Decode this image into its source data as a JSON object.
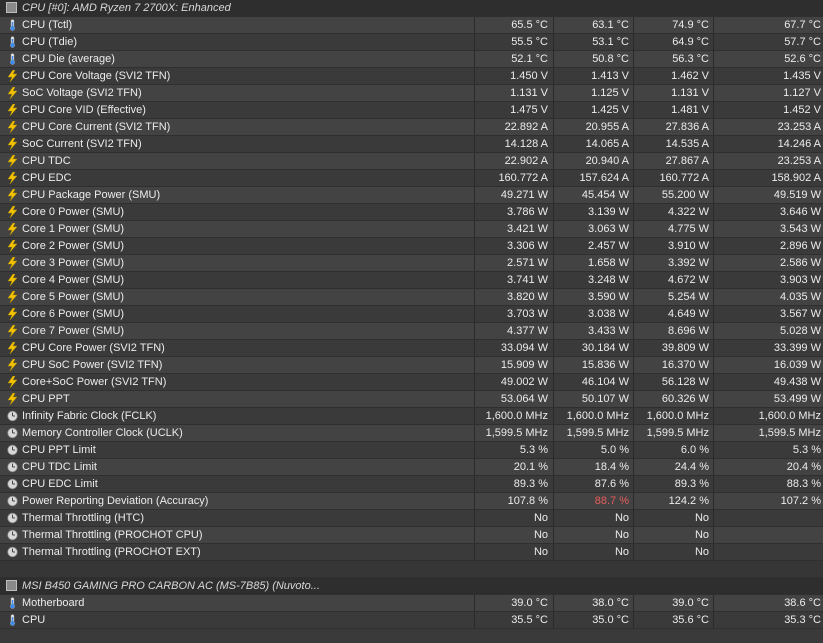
{
  "groups": [
    {
      "title": "CPU [#0]: AMD Ryzen 7 2700X: Enhanced",
      "icon": "chip-icon",
      "rows": [
        {
          "icon": "thermometer-icon",
          "name": "CPU (Tctl)",
          "current": "65.5 °C",
          "min": "63.1 °C",
          "max": "74.9 °C",
          "avg": "67.7 °C"
        },
        {
          "icon": "thermometer-icon",
          "name": "CPU (Tdie)",
          "current": "55.5 °C",
          "min": "53.1 °C",
          "max": "64.9 °C",
          "avg": "57.7 °C"
        },
        {
          "icon": "thermometer-icon",
          "name": "CPU Die (average)",
          "current": "52.1 °C",
          "min": "50.8 °C",
          "max": "56.3 °C",
          "avg": "52.6 °C"
        },
        {
          "icon": "lightning-icon",
          "name": "CPU Core Voltage (SVI2 TFN)",
          "current": "1.450 V",
          "min": "1.413 V",
          "max": "1.462 V",
          "avg": "1.435 V"
        },
        {
          "icon": "lightning-icon",
          "name": "SoC Voltage (SVI2 TFN)",
          "current": "1.131 V",
          "min": "1.125 V",
          "max": "1.131 V",
          "avg": "1.127 V"
        },
        {
          "icon": "lightning-icon",
          "name": "CPU Core VID (Effective)",
          "current": "1.475 V",
          "min": "1.425 V",
          "max": "1.481 V",
          "avg": "1.452 V"
        },
        {
          "icon": "lightning-icon",
          "name": "CPU Core Current (SVI2 TFN)",
          "current": "22.892 A",
          "min": "20.955 A",
          "max": "27.836 A",
          "avg": "23.253 A"
        },
        {
          "icon": "lightning-icon",
          "name": "SoC Current (SVI2 TFN)",
          "current": "14.128 A",
          "min": "14.065 A",
          "max": "14.535 A",
          "avg": "14.246 A"
        },
        {
          "icon": "lightning-icon",
          "name": "CPU TDC",
          "current": "22.902 A",
          "min": "20.940 A",
          "max": "27.867 A",
          "avg": "23.253 A"
        },
        {
          "icon": "lightning-icon",
          "name": "CPU EDC",
          "current": "160.772 A",
          "min": "157.624 A",
          "max": "160.772 A",
          "avg": "158.902 A"
        },
        {
          "icon": "lightning-icon",
          "name": "CPU Package Power (SMU)",
          "current": "49.271 W",
          "min": "45.454 W",
          "max": "55.200 W",
          "avg": "49.519 W"
        },
        {
          "icon": "lightning-icon",
          "name": "Core 0 Power (SMU)",
          "current": "3.786 W",
          "min": "3.139 W",
          "max": "4.322 W",
          "avg": "3.646 W"
        },
        {
          "icon": "lightning-icon",
          "name": "Core 1 Power (SMU)",
          "current": "3.421 W",
          "min": "3.063 W",
          "max": "4.775 W",
          "avg": "3.543 W"
        },
        {
          "icon": "lightning-icon",
          "name": "Core 2 Power (SMU)",
          "current": "3.306 W",
          "min": "2.457 W",
          "max": "3.910 W",
          "avg": "2.896 W"
        },
        {
          "icon": "lightning-icon",
          "name": "Core 3 Power (SMU)",
          "current": "2.571 W",
          "min": "1.658 W",
          "max": "3.392 W",
          "avg": "2.586 W"
        },
        {
          "icon": "lightning-icon",
          "name": "Core 4 Power (SMU)",
          "current": "3.741 W",
          "min": "3.248 W",
          "max": "4.672 W",
          "avg": "3.903 W"
        },
        {
          "icon": "lightning-icon",
          "name": "Core 5 Power (SMU)",
          "current": "3.820 W",
          "min": "3.590 W",
          "max": "5.254 W",
          "avg": "4.035 W"
        },
        {
          "icon": "lightning-icon",
          "name": "Core 6 Power (SMU)",
          "current": "3.703 W",
          "min": "3.038 W",
          "max": "4.649 W",
          "avg": "3.567 W"
        },
        {
          "icon": "lightning-icon",
          "name": "Core 7 Power (SMU)",
          "current": "4.377 W",
          "min": "3.433 W",
          "max": "8.696 W",
          "avg": "5.028 W"
        },
        {
          "icon": "lightning-icon",
          "name": "CPU Core Power (SVI2 TFN)",
          "current": "33.094 W",
          "min": "30.184 W",
          "max": "39.809 W",
          "avg": "33.399 W"
        },
        {
          "icon": "lightning-icon",
          "name": "CPU SoC Power (SVI2 TFN)",
          "current": "15.909 W",
          "min": "15.836 W",
          "max": "16.370 W",
          "avg": "16.039 W"
        },
        {
          "icon": "lightning-icon",
          "name": "Core+SoC Power (SVI2 TFN)",
          "current": "49.002 W",
          "min": "46.104 W",
          "max": "56.128 W",
          "avg": "49.438 W"
        },
        {
          "icon": "lightning-icon",
          "name": "CPU PPT",
          "current": "53.064 W",
          "min": "50.107 W",
          "max": "60.326 W",
          "avg": "53.499 W"
        },
        {
          "icon": "clock-icon",
          "name": "Infinity Fabric Clock (FCLK)",
          "current": "1,600.0 MHz",
          "min": "1,600.0 MHz",
          "max": "1,600.0 MHz",
          "avg": "1,600.0 MHz"
        },
        {
          "icon": "clock-icon",
          "name": "Memory Controller Clock (UCLK)",
          "current": "1,599.5 MHz",
          "min": "1,599.5 MHz",
          "max": "1,599.5 MHz",
          "avg": "1,599.5 MHz"
        },
        {
          "icon": "gauge-icon",
          "name": "CPU PPT Limit",
          "current": "5.3 %",
          "min": "5.0 %",
          "max": "6.0 %",
          "avg": "5.3 %"
        },
        {
          "icon": "gauge-icon",
          "name": "CPU TDC Limit",
          "current": "20.1 %",
          "min": "18.4 %",
          "max": "24.4 %",
          "avg": "20.4 %"
        },
        {
          "icon": "gauge-icon",
          "name": "CPU EDC Limit",
          "current": "89.3 %",
          "min": "87.6 %",
          "max": "89.3 %",
          "avg": "88.3 %"
        },
        {
          "icon": "gauge-icon",
          "name": "Power Reporting Deviation (Accuracy)",
          "current": "107.8 %",
          "min": "88.7 %",
          "max": "124.2 %",
          "avg": "107.2 %",
          "min_alert": true
        },
        {
          "icon": "gauge-icon",
          "name": "Thermal Throttling (HTC)",
          "current": "No",
          "min": "No",
          "max": "No",
          "avg": ""
        },
        {
          "icon": "gauge-icon",
          "name": "Thermal Throttling (PROCHOT CPU)",
          "current": "No",
          "min": "No",
          "max": "No",
          "avg": ""
        },
        {
          "icon": "gauge-icon",
          "name": "Thermal Throttling (PROCHOT EXT)",
          "current": "No",
          "min": "No",
          "max": "No",
          "avg": ""
        }
      ]
    },
    {
      "title": "MSI B450 GAMING PRO CARBON AC (MS-7B85) (Nuvoto...",
      "icon": "chip-icon",
      "rows": [
        {
          "icon": "thermometer-icon",
          "name": "Motherboard",
          "current": "39.0 °C",
          "min": "38.0 °C",
          "max": "39.0 °C",
          "avg": "38.6 °C"
        },
        {
          "icon": "thermometer-icon",
          "name": "CPU",
          "current": "35.5 °C",
          "min": "35.0 °C",
          "max": "35.6 °C",
          "avg": "35.3 °C"
        }
      ]
    }
  ],
  "colors": {
    "alert": "#e85b5b",
    "lightning": "#f2c200",
    "thermometer": "#4aa3ff"
  }
}
